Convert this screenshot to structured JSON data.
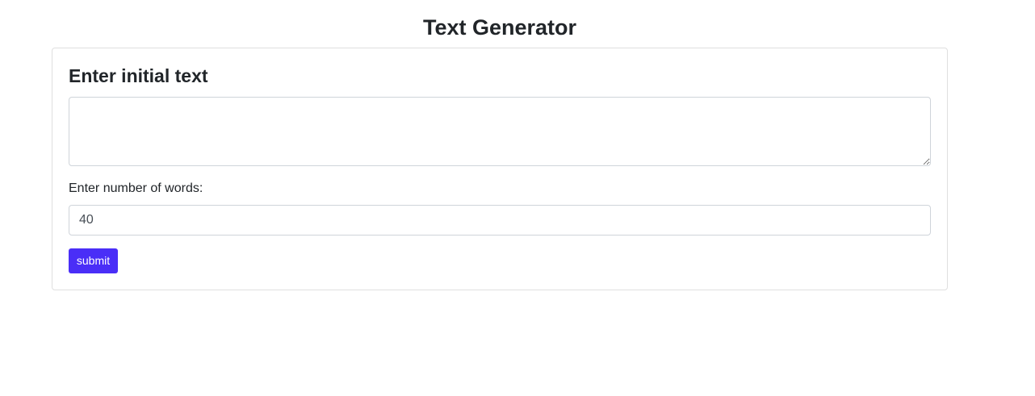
{
  "header": {
    "title": "Text Generator"
  },
  "form": {
    "heading": "Enter initial text",
    "initial_text": {
      "value": "",
      "placeholder": ""
    },
    "words_label": "Enter number of words:",
    "words_value": "40",
    "submit_label": "submit"
  },
  "colors": {
    "accent": "#4a2ef7",
    "text": "#212529",
    "border": "#dfdfdf"
  }
}
